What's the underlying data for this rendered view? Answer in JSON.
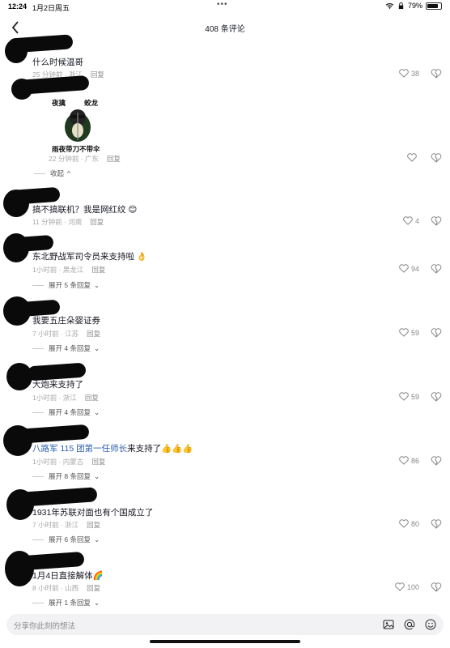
{
  "status": {
    "time": "12:24",
    "date": "1月2日周五",
    "battery": "79%",
    "battery_level": 0.79
  },
  "header": {
    "title": "408 条评论"
  },
  "comments": [
    {
      "text": "什么时候温哥",
      "time": "25 分钟前",
      "location": "浙江",
      "reply": "回复",
      "likes": "38"
    },
    {
      "sticker_top": "夜擒",
      "sticker_right": "蛟龙",
      "sticker_bottom": "雨夜带刀不带伞",
      "time": "22 分钟前",
      "location": "广东",
      "reply": "回复",
      "likes": "",
      "collapse": "收起"
    },
    {
      "text": "搞不搞联机？我是网红纹",
      "time": "11 分钟前",
      "location": "河南",
      "reply": "回复",
      "likes": "4"
    },
    {
      "text": "东北野战军司令员来支持啦",
      "time": "1小时前",
      "location": "黑龙江",
      "reply": "回复",
      "likes": "94",
      "expand": "展开 5 条回复"
    },
    {
      "text": "我要五庄朵婴证券",
      "time": "7 小时前",
      "location": "江苏",
      "reply": "回复",
      "likes": "59",
      "expand": "展开 4 条回复"
    },
    {
      "text": "大炮来支持了",
      "time": "1小时前",
      "location": "浙江",
      "reply": "回复",
      "likes": "59",
      "expand": "展开 4 条回复"
    },
    {
      "text_highlight": "八路军 115 团第一任师长",
      "text_rest": "来支持了",
      "time": "1小时前",
      "location": "内蒙古",
      "reply": "回复",
      "likes": "86",
      "expand": "展开 8 条回复"
    },
    {
      "text": "1931年苏联对面也有个国成立了",
      "time": "7 小时前",
      "location": "浙江",
      "reply": "回复",
      "likes": "80",
      "expand": "展开 6 条回复"
    },
    {
      "text": "1月4日直接解体",
      "time": "8 小时前",
      "location": "山西",
      "reply": "回复",
      "likes": "100",
      "expand": "展开 1 条回复"
    }
  ],
  "input": {
    "placeholder": "分享你此刻的想法"
  }
}
